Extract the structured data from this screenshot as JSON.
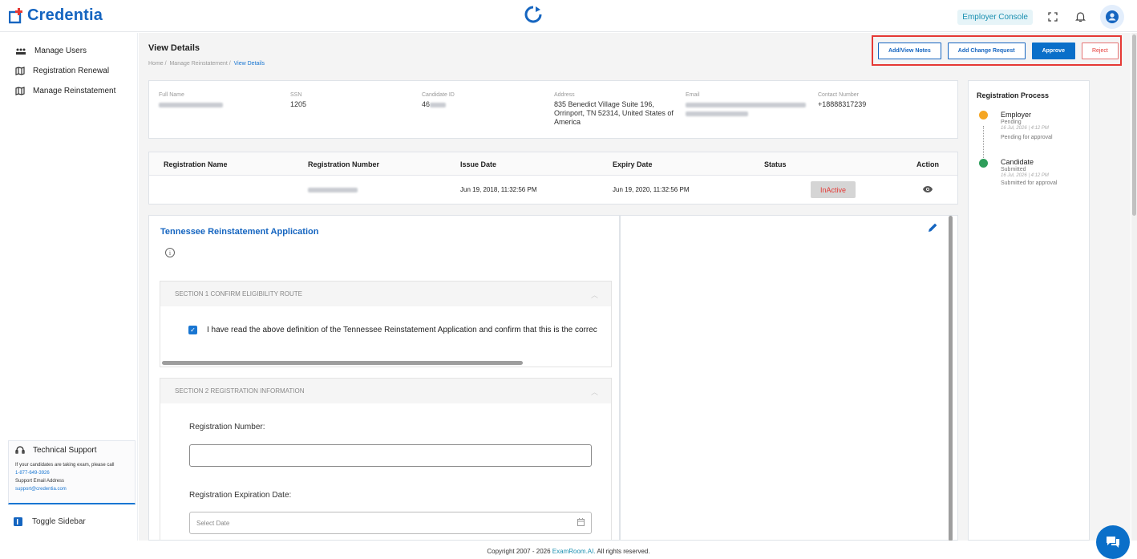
{
  "header": {
    "app_name": "Credentia",
    "console_label": "Employer Console"
  },
  "sidebar": {
    "items": [
      {
        "label": "Manage Users",
        "icon": "users-icon"
      },
      {
        "label": "Registration Renewal",
        "icon": "map-icon"
      },
      {
        "label": "Manage Reinstatement",
        "icon": "map-icon"
      }
    ],
    "support": {
      "title": "Technical Support",
      "line1": "If your candidates are taking exam, please call",
      "phone": "1-877-649-3926",
      "line2": "Support Email Address",
      "email": "support@credentia.com"
    },
    "toggle_label": "Toggle Sidebar"
  },
  "page": {
    "title": "View Details",
    "breadcrumb": [
      "Home",
      "Manage Reinstatement",
      "View Details"
    ],
    "actions": {
      "notes": "Add/View Notes",
      "change_request": "Add Change Request",
      "approve": "Approve",
      "reject": "Reject"
    }
  },
  "candidate": {
    "labels": {
      "full_name": "Full Name",
      "ssn": "SSN",
      "candidate_id": "Candidate ID",
      "address": "Address",
      "email": "Email",
      "contact": "Contact Number"
    },
    "ssn": "1205",
    "candidate_id": "46",
    "address": "835 Benedict Village Suite 196, Orrinport, TN 52314, United States of America",
    "contact": "+18888317239"
  },
  "registration_table": {
    "columns": [
      "Registration Name",
      "Registration Number",
      "Issue Date",
      "Expiry Date",
      "Status",
      "Action"
    ],
    "rows": [
      {
        "name": "",
        "number": "",
        "issue_date": "Jun 19, 2018, 11:32:56 PM",
        "expiry_date": "Jun 19, 2020, 11:32:56 PM",
        "status": "InActive"
      }
    ]
  },
  "form": {
    "title": "Tennessee Reinstatement Application",
    "section1": {
      "title": "SECTION 1  CONFIRM ELIGIBILITY ROUTE",
      "checkbox_text": "I have read the above definition of the Tennessee Reinstatement Application and confirm that this is the correc"
    },
    "section2": {
      "title": "SECTION 2  REGISTRATION INFORMATION",
      "reg_number_label": "Registration Number:",
      "reg_number_value": "",
      "exp_date_label": "Registration Expiration Date:",
      "exp_date_placeholder": "Select Date"
    }
  },
  "process": {
    "title": "Registration Process",
    "steps": [
      {
        "name": "Employer",
        "status": "Pending",
        "timestamp": "16 Jul, 2026 | 4:12 PM",
        "note": "Pending for approval",
        "color": "#f5a623"
      },
      {
        "name": "Candidate",
        "status": "Submitted",
        "timestamp": "16 Jul, 2026 | 4:12 PM",
        "note": "Submitted for approval",
        "color": "#2e9e5b"
      }
    ]
  },
  "footer": {
    "prefix": "Copyright 2007 - 2026",
    "brand": "ExamRoom.AI.",
    "suffix": "All rights reserved."
  },
  "colors": {
    "primary": "#0a6fc9",
    "brand": "#1565c0",
    "danger": "#e53935",
    "pending": "#f5a623",
    "success": "#2e9e5b"
  }
}
